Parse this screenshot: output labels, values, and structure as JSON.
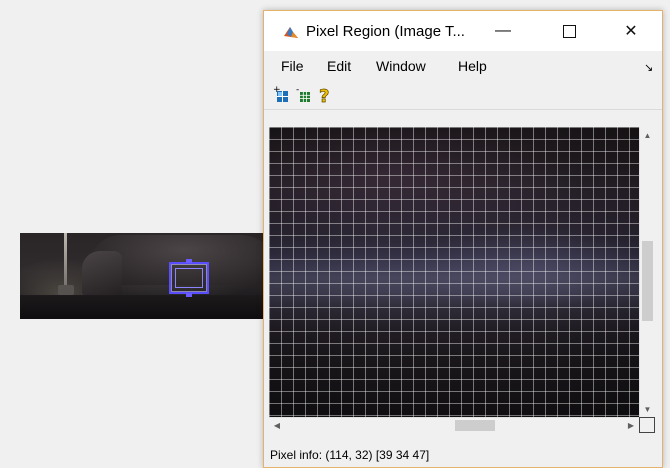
{
  "window": {
    "title": "Pixel Region (Image T...",
    "minimize_glyph": "—",
    "close_glyph": "✕"
  },
  "menu": {
    "items": [
      {
        "label": "File"
      },
      {
        "label": "Edit"
      },
      {
        "label": "Window"
      },
      {
        "label": "Help"
      }
    ],
    "dock_glyph": "↘"
  },
  "toolbar": {
    "buttons": [
      {
        "icon": "expand-grid-icon"
      },
      {
        "icon": "shrink-grid-icon"
      },
      {
        "icon": "help-question-icon"
      }
    ]
  },
  "status": {
    "pixel_info": "Pixel info: (114, 32)  [39 34 47]"
  },
  "colors": {
    "window_border": "#e4b26a",
    "selection": "#5a4cff"
  }
}
